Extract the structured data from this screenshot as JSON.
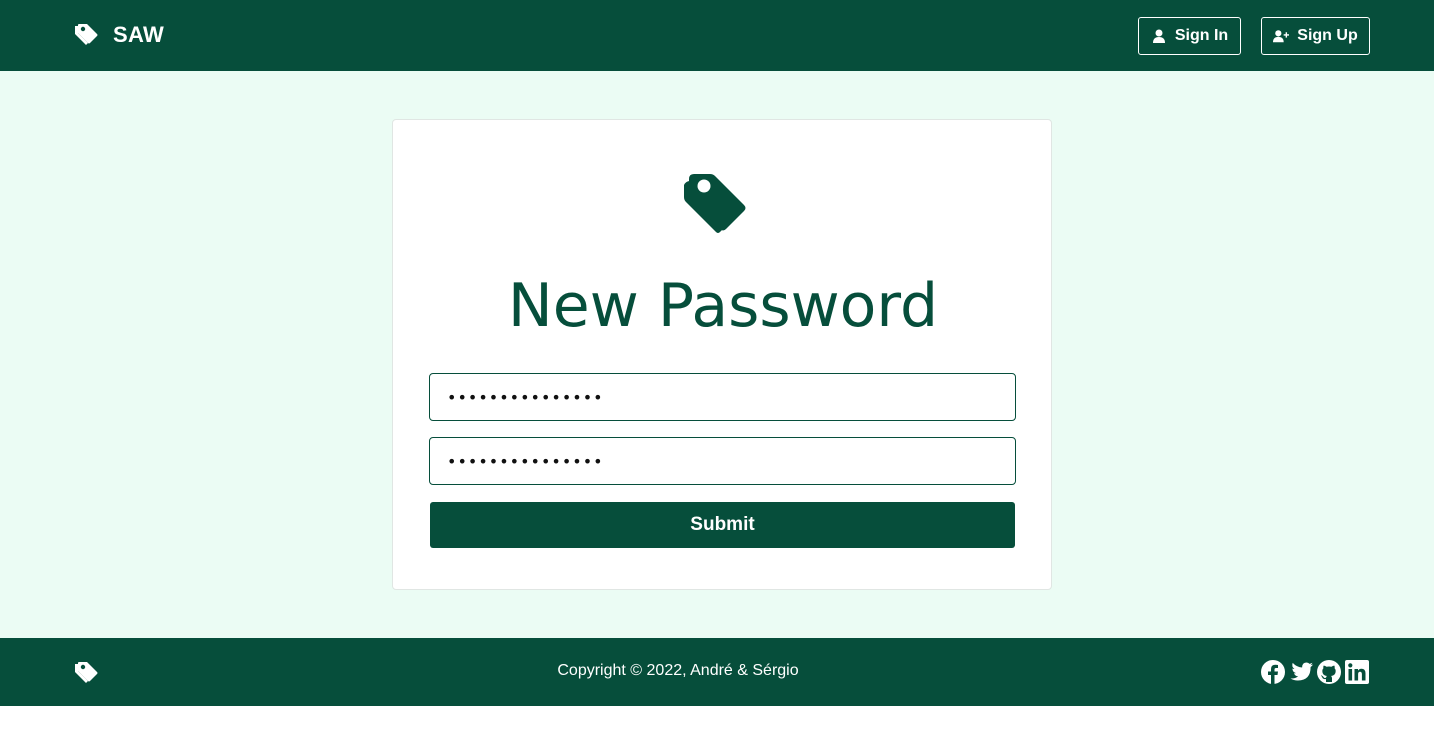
{
  "header": {
    "brand": "SAW",
    "brand_icon": "tags-icon",
    "sign_in_label": "Sign In",
    "sign_in_icon": "user-icon",
    "sign_up_label": "Sign Up",
    "sign_up_icon": "user-plus-icon"
  },
  "card": {
    "logo_icon": "tags-icon",
    "title": "New Password",
    "password_value": "•••••••••••••••",
    "confirm_password_value": "•••••••••••••••",
    "submit_label": "Submit"
  },
  "footer": {
    "logo_icon": "tags-icon",
    "copyright": "Copyright © 2022, André & Sérgio",
    "socials": [
      "facebook-icon",
      "twitter-icon",
      "github-icon",
      "linkedin-icon"
    ]
  },
  "colors": {
    "primary": "#064e3b",
    "background": "#ebfcf4",
    "card": "#ffffff",
    "text_on_primary": "#ffffff"
  }
}
